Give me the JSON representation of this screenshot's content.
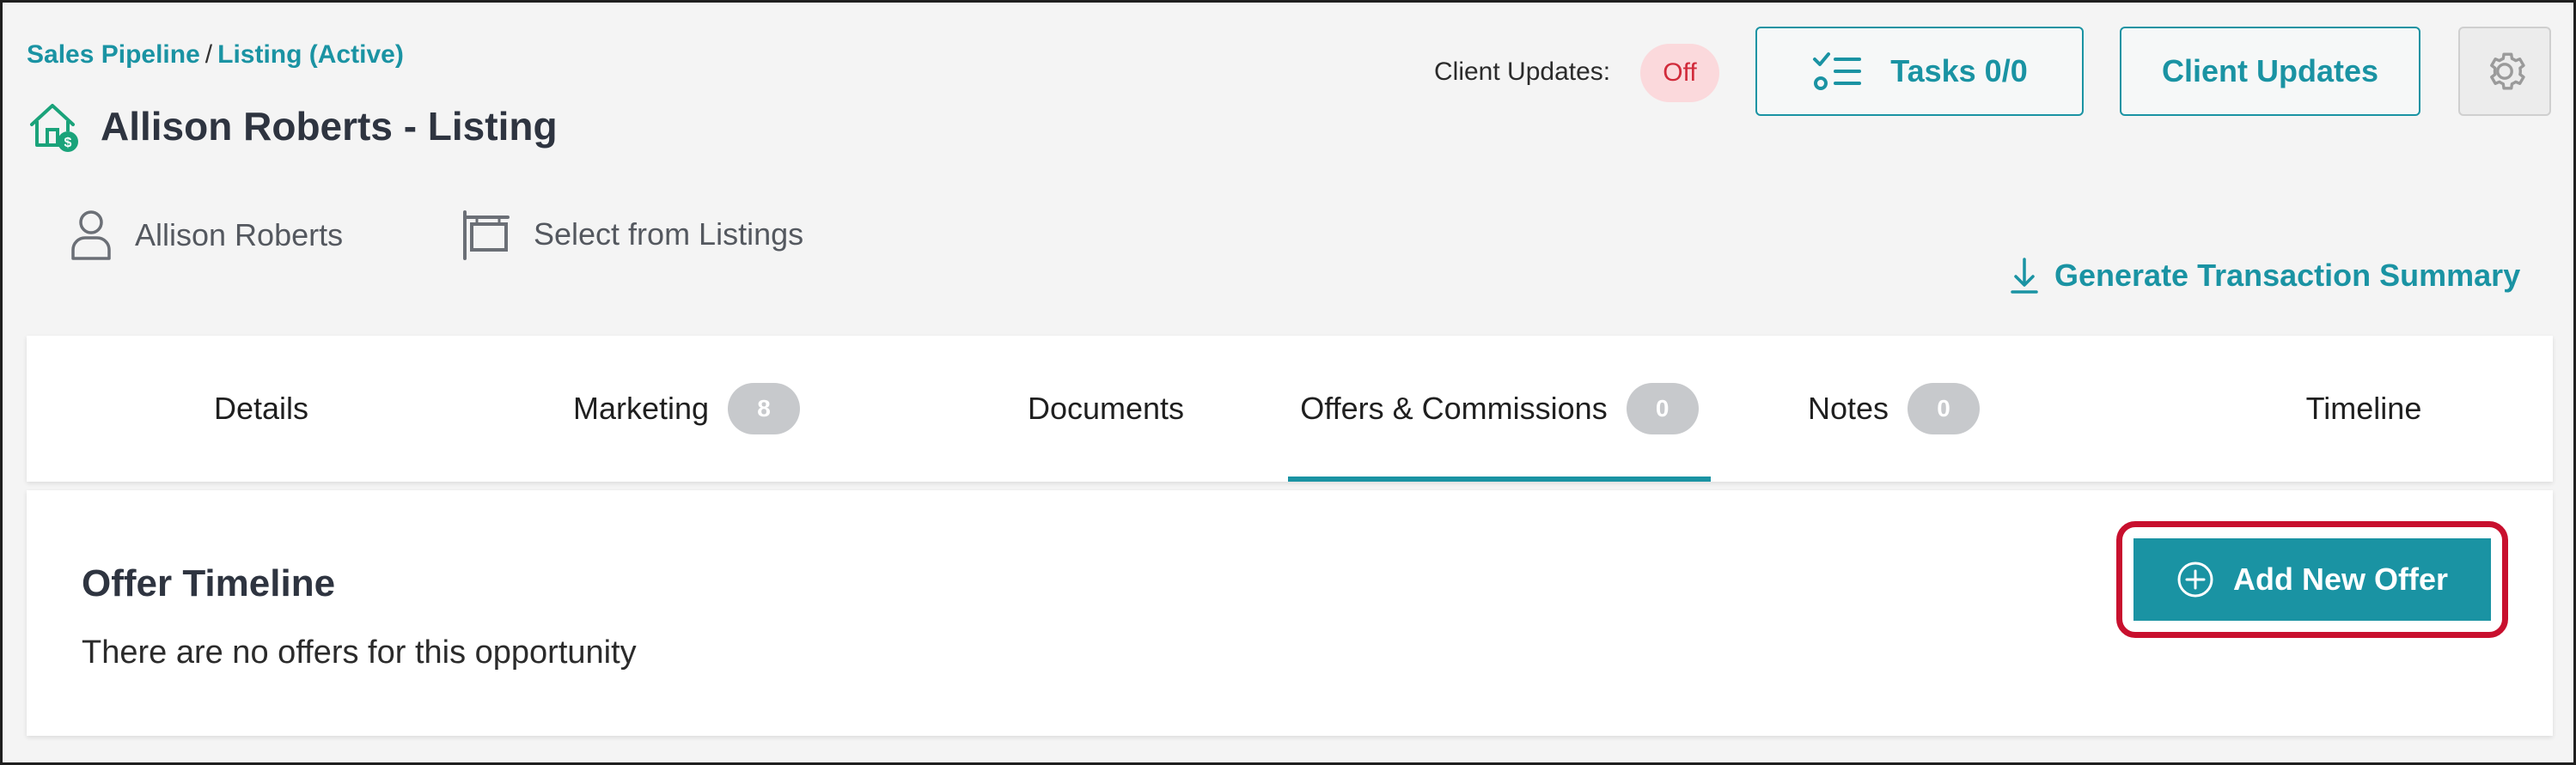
{
  "breadcrumb": {
    "parent": "Sales Pipeline",
    "separator": "/",
    "current": "Listing (Active)"
  },
  "page_title": "Allison Roberts - Listing",
  "header": {
    "client_updates_label": "Client Updates:",
    "client_updates_status": "Off",
    "tasks_button": "Tasks 0/0",
    "client_updates_button": "Client Updates",
    "settings_icon": "gear-icon"
  },
  "meta": {
    "person_name": "Allison Roberts",
    "listing_select": "Select from Listings"
  },
  "generate_summary": "Generate Transaction Summary",
  "tabs": [
    {
      "label": "Details",
      "count": null
    },
    {
      "label": "Marketing",
      "count": "8"
    },
    {
      "label": "Documents",
      "count": null
    },
    {
      "label": "Offers & Commissions",
      "count": "0",
      "active": true
    },
    {
      "label": "Notes",
      "count": "0"
    },
    {
      "label": "Timeline",
      "count": null
    }
  ],
  "offers": {
    "title": "Offer Timeline",
    "empty_message": "There are no offers for this opportunity",
    "add_button": "Add New Offer"
  },
  "colors": {
    "accent": "#1a93a3",
    "highlight": "#c8102e",
    "status_off_bg": "#fbd9dc",
    "status_off_text": "#d12b3b"
  }
}
